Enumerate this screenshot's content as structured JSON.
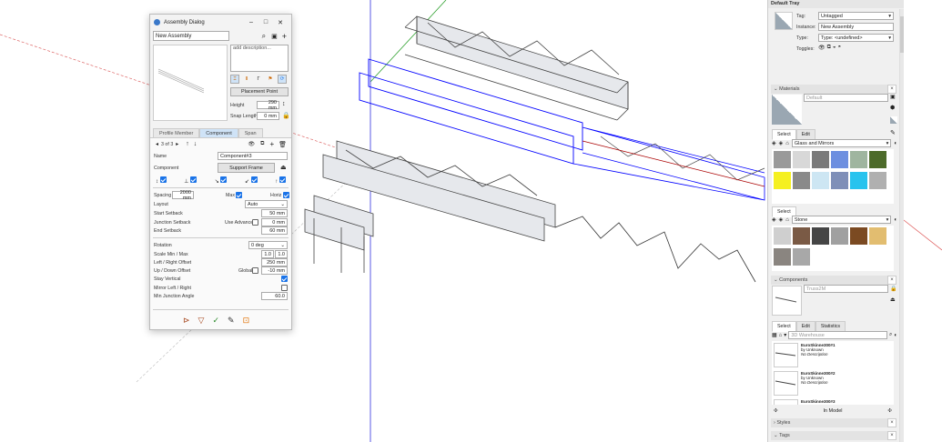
{
  "assembly_dialog": {
    "title": "Assembly Dialog",
    "assembly_name": "New Assembly",
    "description_placeholder": "add description...",
    "placement_point_label": "Placement Point",
    "height_label": "Height",
    "height_value": "290 mm",
    "snap_length_label": "Snap Length",
    "snap_length_value": "0 mm",
    "tabs": [
      {
        "label": "Profile Member",
        "active": false
      },
      {
        "label": "Component",
        "active": true
      },
      {
        "label": "Span",
        "active": false
      }
    ],
    "pager": "3 of 3",
    "name_label": "Name",
    "name_value": "Component#3",
    "component_label": "Component",
    "component_value": "Support Frame",
    "spacing_label": "Spacing",
    "spacing_value": "2000 mm",
    "max_label": "Max",
    "max_checked": true,
    "horiz_label": "Horiz",
    "horiz_checked": true,
    "layout_label": "Layout",
    "layout_value": "Auto",
    "start_setback_label": "Start Setback",
    "start_setback_value": "50 mm",
    "junction_setback_label": "Junction Setback",
    "use_advanced_label": "Use Advanced",
    "use_advanced_checked": false,
    "junction_setback_value": "0 mm",
    "end_setback_label": "End Setback",
    "end_setback_value": "60 mm",
    "rotation_label": "Rotation",
    "rotation_value": "0 deg",
    "scale_label": "Scale Min / Max",
    "scale_min": "1.0",
    "scale_max": "1.0",
    "lr_offset_label": "Left / Right Offset",
    "lr_offset_value": "250 mm",
    "ud_offset_label": "Up / Down Offset",
    "global_label": "Global",
    "global_checked": false,
    "ud_offset_value": "-10 mm",
    "stay_vertical_label": "Stay Vertical",
    "stay_vertical_checked": true,
    "mirror_label": "Mirror Left / Right",
    "mirror_checked": false,
    "min_junction_label": "Min Junction Angle",
    "min_junction_value": "60.0"
  },
  "tray": {
    "title": "Default Tray",
    "entity": {
      "tag_label": "Tag:",
      "tag_value": "Untagged",
      "instance_label": "Instance:",
      "instance_value": "New Assembly",
      "type_label": "Type:",
      "type_value": "Type: <undefined>",
      "toggles_label": "Toggles:"
    },
    "materials": {
      "header": "Materials",
      "name_placeholder": "Default",
      "tabs": [
        "Select",
        "Edit"
      ],
      "library": "Glass and Mirrors",
      "swatches": [
        "#9a9a9a",
        "#d8d8d8",
        "#7a7a7a",
        "#6d8fe0",
        "#9fb59f",
        "#4d6b2a",
        "#f5f020",
        "#8a8a8a",
        "#cde6f3",
        "#7f8fb8",
        "#28c3ee",
        "#b0b0b0"
      ],
      "select_tab": "Select",
      "library2": "Stone",
      "swatches2": [
        "#cfcfcf",
        "#7a5a45",
        "#454545",
        "#a0a0a0",
        "#7b4a22",
        "#e2bd70",
        "#8a8580",
        "#a8a8a8"
      ]
    },
    "components": {
      "header": "Components",
      "name_placeholder": "Truss2M",
      "tabs": [
        "Select",
        "Edit",
        "Statistics"
      ],
      "search_placeholder": "3D Warehouse",
      "items": [
        {
          "name": "EuroSkinne300#1",
          "by": "by Unknown",
          "desc": "No Description"
        },
        {
          "name": "EuroSkinne300#2",
          "by": "by Unknown",
          "desc": "No Description"
        },
        {
          "name": "EuroSkinne300#3"
        }
      ],
      "footer": "In Model"
    },
    "styles_header": "Styles",
    "tags_header": "Tags"
  },
  "colors": {
    "accent": "#1a73e8",
    "selection": "#0000ff",
    "axis_red": "#d04040",
    "axis_green": "#2ca02c",
    "axis_blue": "#3030e0"
  }
}
